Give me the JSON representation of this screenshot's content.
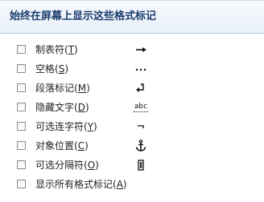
{
  "section": {
    "title": "始终在屏幕上显示这些格式标记"
  },
  "options": [
    {
      "label": "制表符",
      "accel": "T",
      "icon": "tab-arrow-icon"
    },
    {
      "label": "空格",
      "accel": "S",
      "icon": "space-dots-icon"
    },
    {
      "label": "段落标记",
      "accel": "M",
      "icon": "paragraph-mark-icon"
    },
    {
      "label": "隐藏文字",
      "accel": "D",
      "icon": "hidden-text-icon",
      "mark_text": "abc"
    },
    {
      "label": "可选连字符",
      "accel": "Y",
      "icon": "optional-hyphen-icon"
    },
    {
      "label": "对象位置",
      "accel": "C",
      "icon": "anchor-icon"
    },
    {
      "label": "可选分隔符",
      "accel": "O",
      "icon": "optional-break-icon"
    },
    {
      "label": "显示所有格式标记",
      "accel": "A",
      "icon": null
    }
  ]
}
